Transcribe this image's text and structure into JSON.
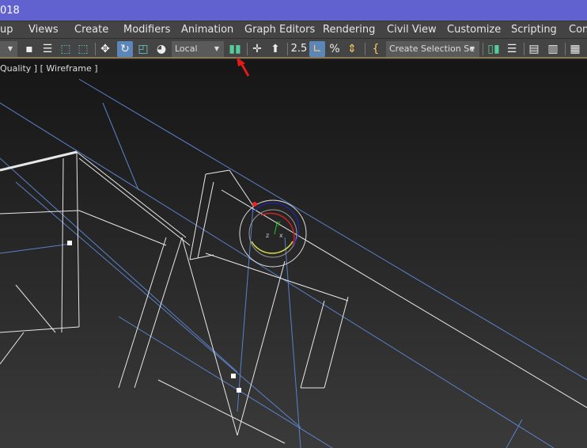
{
  "title": "018",
  "menu": [
    "up",
    "Views",
    "Create",
    "Modifiers",
    "Animation",
    "Graph Editors",
    "Rendering",
    "Civil View",
    "Customize",
    "Scripting",
    "Cont"
  ],
  "toolbar": {
    "coord_system": "Local",
    "selection_set": "Create Selection Se",
    "snap_label": "2.5"
  },
  "viewport": {
    "label": "Quality ] [ Wireframe ]"
  },
  "gizmo": {
    "x": "x",
    "y": "y",
    "z": "z"
  },
  "colors": {
    "title_bar": "#6161cf",
    "annotation_arrow": "#e01b1b",
    "wire_white": "#e8e8e8",
    "wire_blue": "#5a82c8"
  }
}
